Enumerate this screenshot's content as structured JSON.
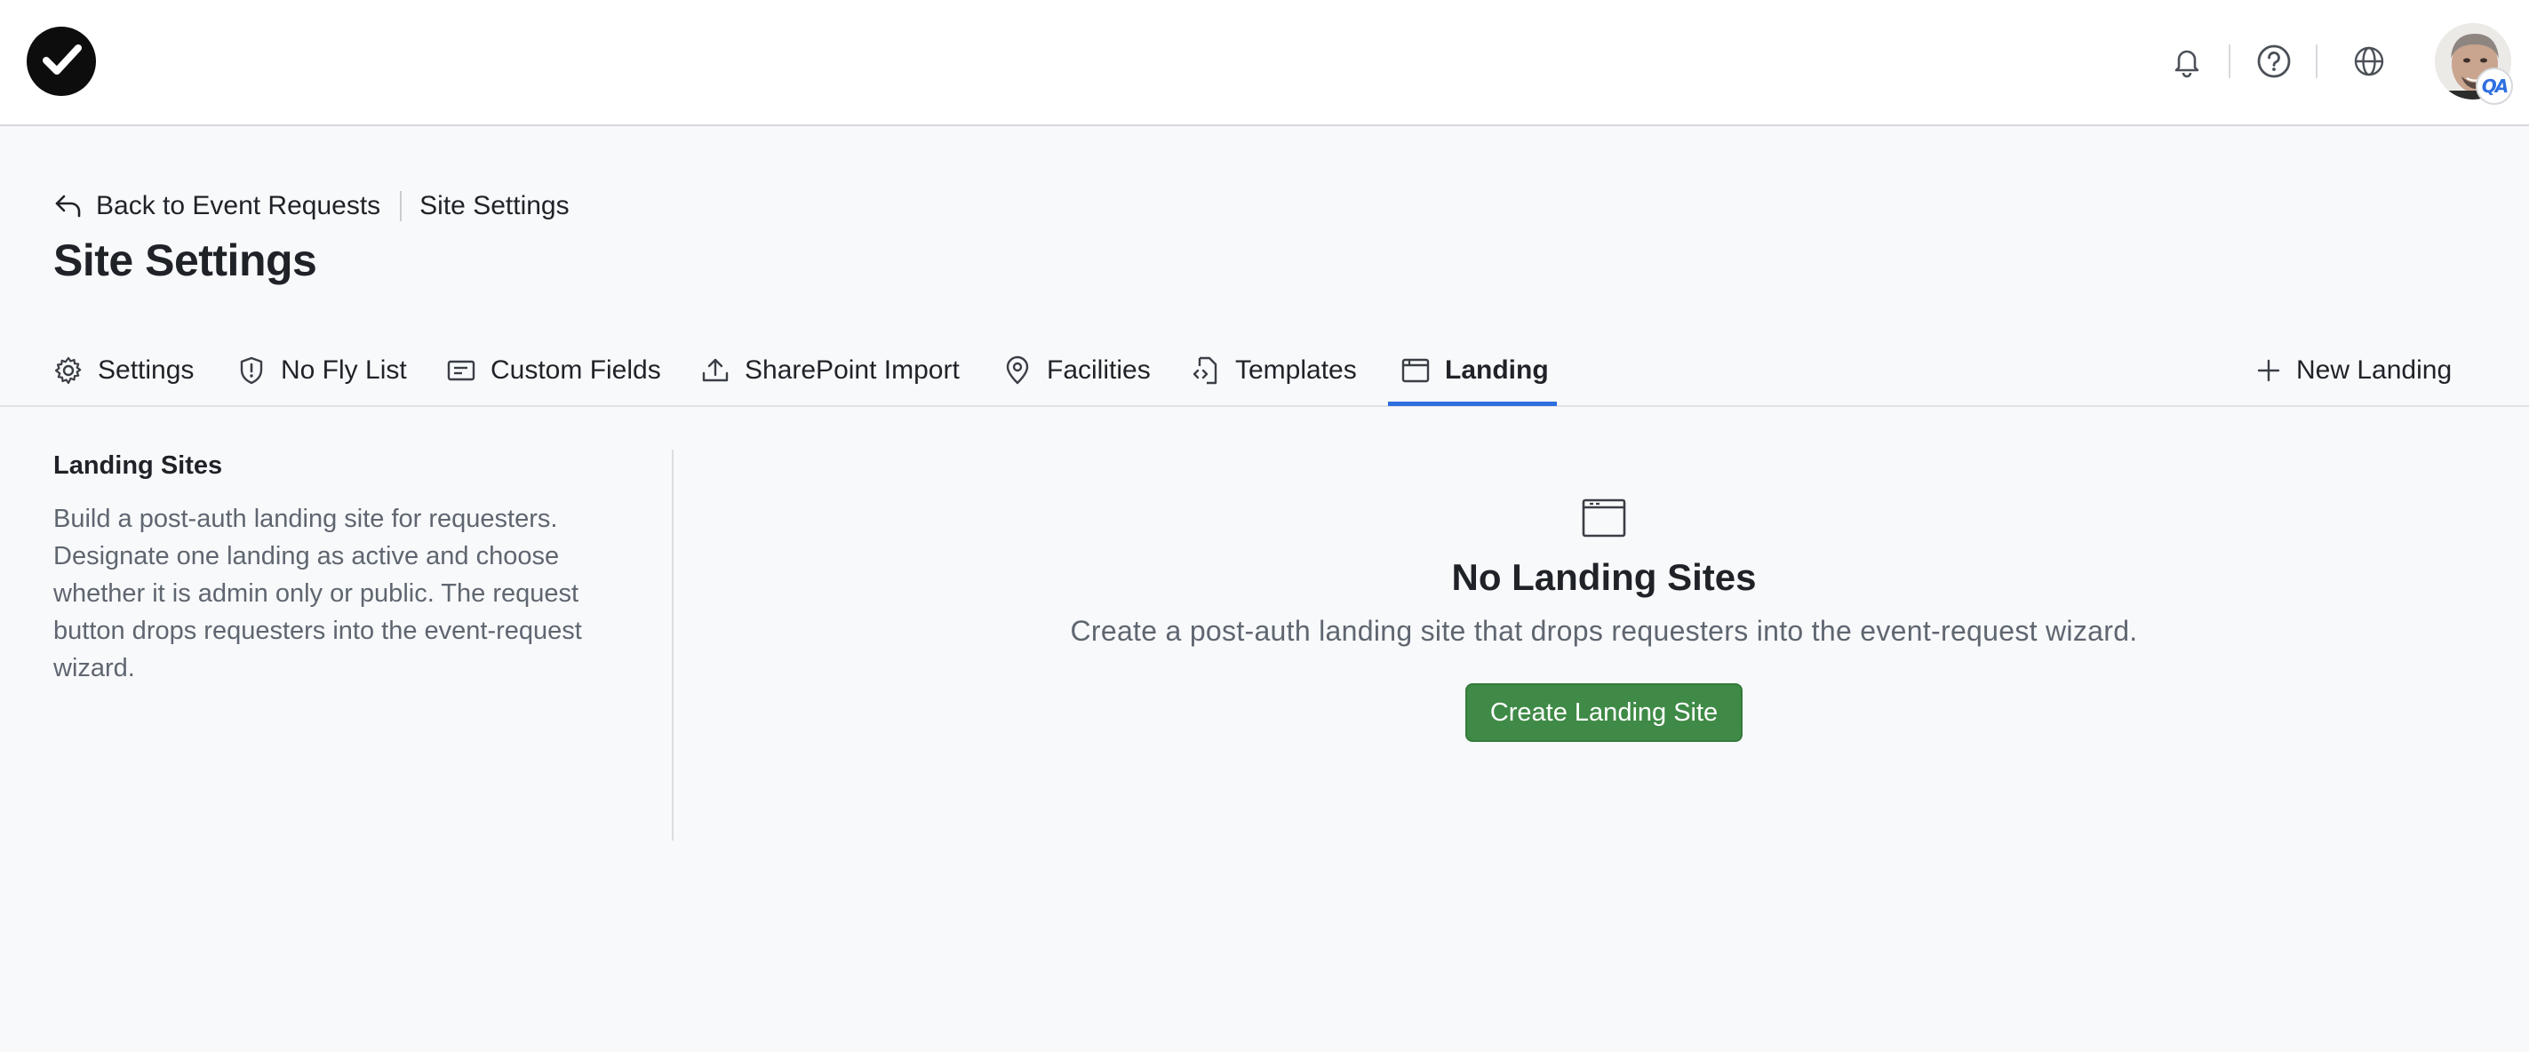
{
  "header": {
    "logo_icon": "checkmark-circle-icon",
    "notifications_icon": "bell-icon",
    "help_icon": "question-circle-icon",
    "language_icon": "globe-icon",
    "avatar_badge": "QA"
  },
  "breadcrumb": {
    "back_label": "Back to Event Requests",
    "current": "Site Settings"
  },
  "page": {
    "title": "Site Settings"
  },
  "tabs": [
    {
      "label": "Settings",
      "icon": "gear-icon"
    },
    {
      "label": "No Fly List",
      "icon": "shield-alert-icon"
    },
    {
      "label": "Custom Fields",
      "icon": "form-field-icon"
    },
    {
      "label": "SharePoint Import",
      "icon": "upload-icon"
    },
    {
      "label": "Facilities",
      "icon": "map-pin-icon"
    },
    {
      "label": "Templates",
      "icon": "code-file-icon"
    },
    {
      "label": "Landing",
      "icon": "browser-window-icon",
      "active": true
    }
  ],
  "new_landing_label": "New Landing",
  "sidebar": {
    "title": "Landing Sites",
    "description": "Build a post-auth landing site for requesters. Designate one landing as active and choose whether it is admin only or public. The request button drops requesters into the event-request wizard."
  },
  "empty_state": {
    "icon": "browser-window-icon",
    "title": "No Landing Sites",
    "message": "Create a post-auth landing site that drops requesters into the event-request wizard.",
    "button_label": "Create Landing Site"
  },
  "colors": {
    "accent": "#2f6fe0",
    "primary_button": "#3f8a46",
    "background": "#f8f9fb"
  }
}
